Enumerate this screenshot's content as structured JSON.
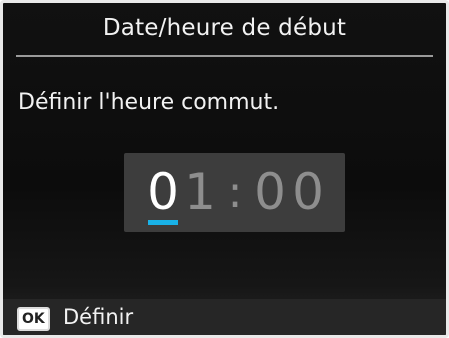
{
  "header": {
    "title": "Date/heure de début"
  },
  "main": {
    "prompt": "Définir l'heure commut.",
    "time": {
      "hour_tens": "0",
      "hour_units": "1",
      "separator": ":",
      "minute_tens": "0",
      "minute_units": "0",
      "selected_digit": "hour_tens"
    }
  },
  "footer": {
    "key_label": "OK",
    "action_label": "Définir"
  },
  "colors": {
    "cursor": "#19b2e8",
    "background": "#0c0c0c",
    "time_box": "#3d3d3d"
  }
}
